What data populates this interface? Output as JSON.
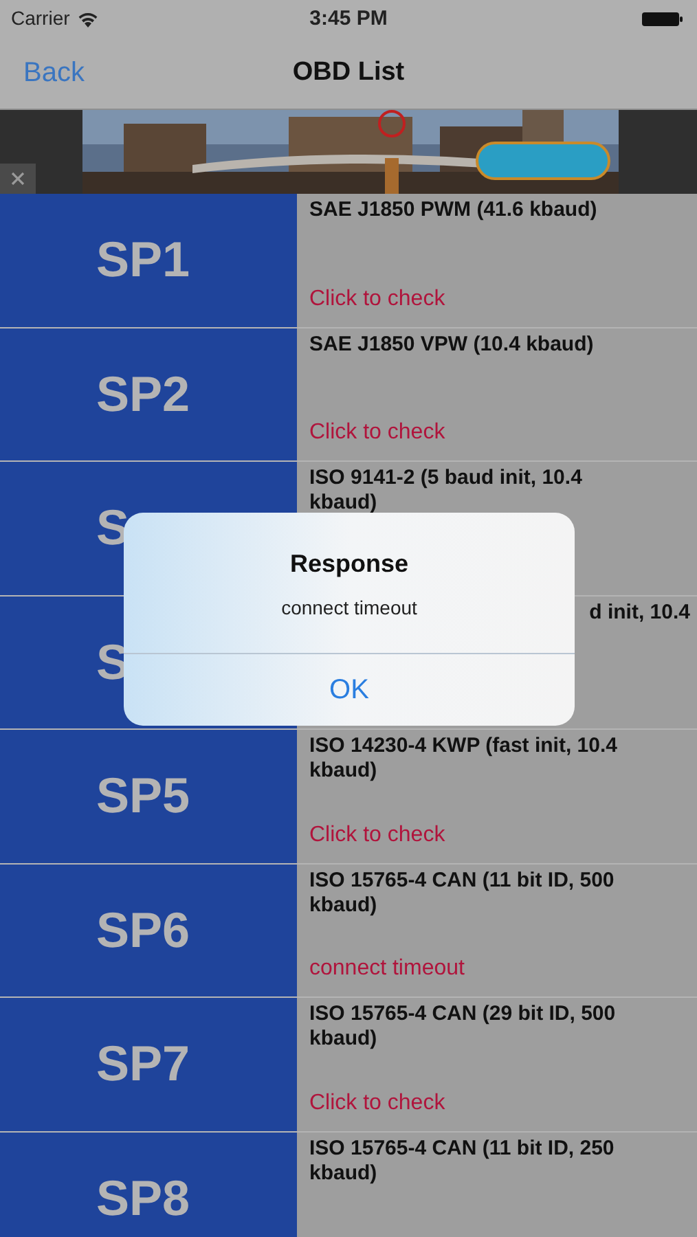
{
  "status_bar": {
    "carrier": "Carrier",
    "time": "3:45 PM"
  },
  "nav": {
    "back": "Back",
    "title": "OBD List"
  },
  "rows": [
    {
      "kind": "full",
      "label": "SP1",
      "title": "SAE J1850 PWM (41.6 kbaud)",
      "status": "Click to check"
    },
    {
      "kind": "full",
      "label": "SP2",
      "title": "SAE J1850 VPW (10.4 kbaud)",
      "status": "Click to check"
    },
    {
      "kind": "full",
      "label": "S",
      "title": "ISO 9141-2 (5 baud init, 10.4 kbaud)"
    },
    {
      "kind": "tail",
      "label": "S",
      "title": "d init, 10.4"
    },
    {
      "kind": "full",
      "label": "SP5",
      "title": "ISO 14230-4 KWP (fast init, 10.4 kbaud)",
      "status": "Click to check"
    },
    {
      "kind": "full",
      "label": "SP6",
      "title": "ISO 15765-4 CAN (11 bit ID, 500 kbaud)",
      "status": "connect timeout"
    },
    {
      "kind": "full",
      "label": "SP7",
      "title": "ISO 15765-4 CAN (29 bit ID, 500 kbaud)",
      "status": "Click to check"
    },
    {
      "kind": "full",
      "label": "SP8",
      "title": "ISO 15765-4 CAN (11 bit ID, 250 kbaud)"
    }
  ],
  "alert": {
    "title": "Response",
    "message": "connect timeout",
    "button": "OK"
  }
}
